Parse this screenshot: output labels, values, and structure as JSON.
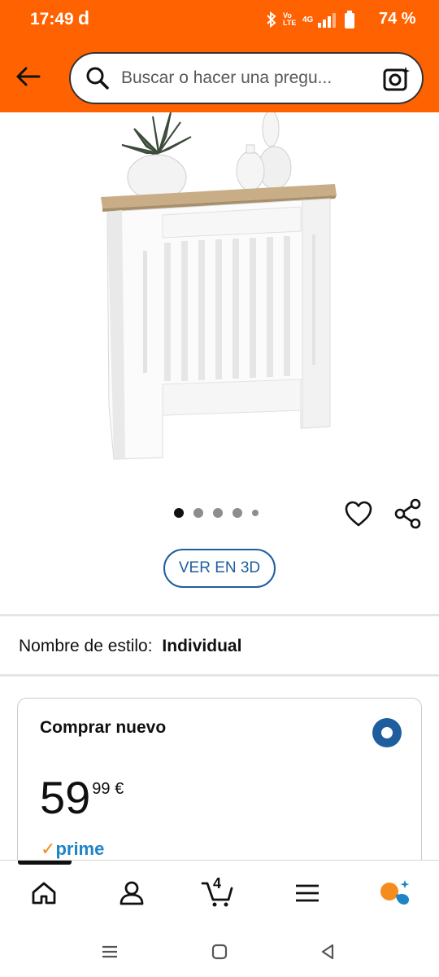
{
  "status_bar": {
    "time": "17:49",
    "carrier_glyph": "d",
    "battery": "74 %",
    "icons": [
      "bluetooth-icon",
      "volte-icon",
      "4g-icon",
      "signal-icon",
      "battery-icon"
    ],
    "volte_label": "Vo LTE",
    "network_label": "4G"
  },
  "header": {
    "search_placeholder": "Buscar o hacer una pregu...",
    "accent_color": "#ff6200"
  },
  "product": {
    "image": "white-radiator-cover-with-wood-top",
    "carousel": {
      "total": 5,
      "active": 1
    },
    "view_3d_label": "VER EN 3D"
  },
  "style": {
    "label": "Nombre de estilo:",
    "value": "Individual"
  },
  "buy_box": {
    "title": "Comprar nuevo",
    "price_whole": "59",
    "price_fraction": "99 €",
    "prime_check": "✓",
    "prime_label": "prime",
    "radio_selected": true,
    "accent_color": "#1e5e9e"
  },
  "bottom_nav": {
    "items": [
      "home-icon",
      "account-icon",
      "cart-icon",
      "menu-icon",
      "assistant-icon"
    ],
    "cart_count": "4",
    "active_index": 0
  },
  "system_nav": {
    "items": [
      "recents-icon",
      "home-circle-icon",
      "back-triangle-icon"
    ]
  }
}
